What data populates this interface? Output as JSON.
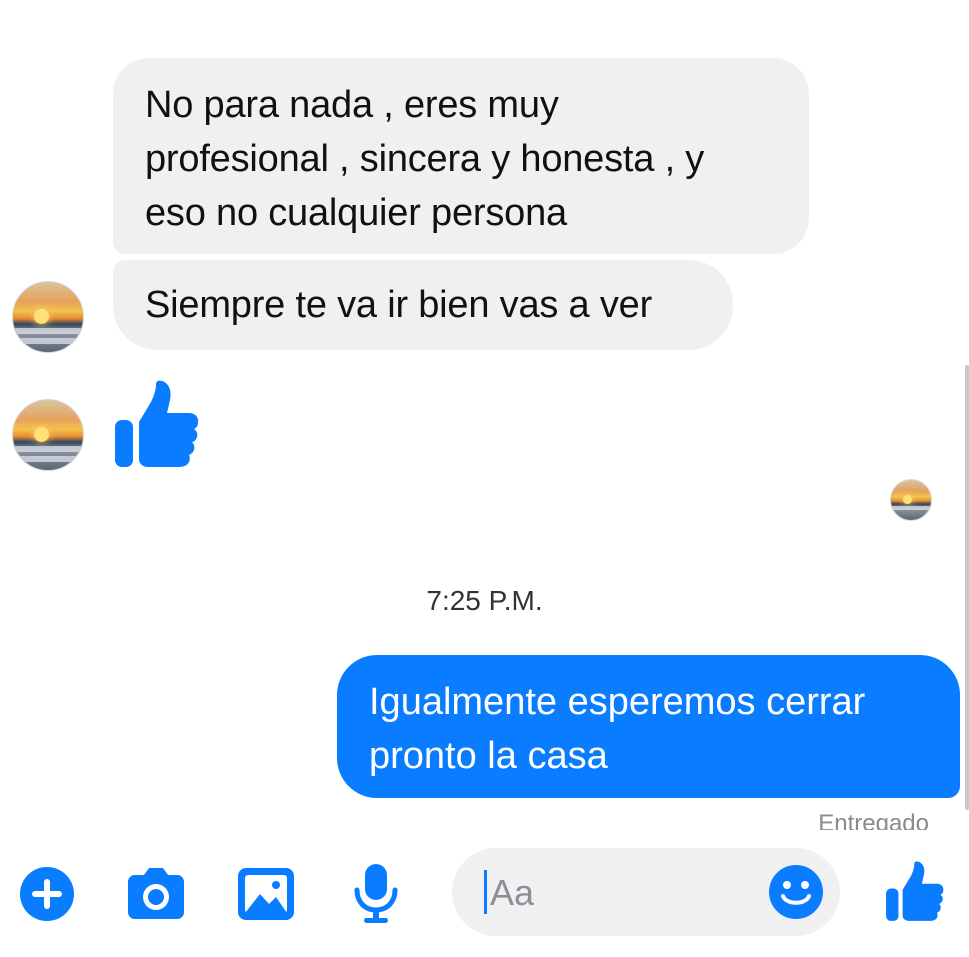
{
  "colors": {
    "accent": "#0a7cff",
    "incoming_bubble": "#f0f0f3",
    "outgoing_text": "#ffffff"
  },
  "messages": [
    {
      "direction": "incoming",
      "text": "No para nada , eres muy\nprofesional , sincera y honesta , y\neso no cualquier persona"
    },
    {
      "direction": "incoming",
      "text": "Siempre te va ir bien vas a ver"
    },
    {
      "direction": "incoming",
      "type": "like",
      "icon": "thumbs-up-icon"
    },
    {
      "direction": "outgoing",
      "text": "Igualmente esperemos cerrar\npronto la casa"
    }
  ],
  "timestamp": "7:25 P.M.",
  "delivery_status": "Entregado",
  "composer": {
    "placeholder": "Aa",
    "icons": [
      "plus-icon",
      "camera-icon",
      "image-icon",
      "microphone-icon",
      "emoji-icon",
      "thumbs-up-icon"
    ]
  }
}
